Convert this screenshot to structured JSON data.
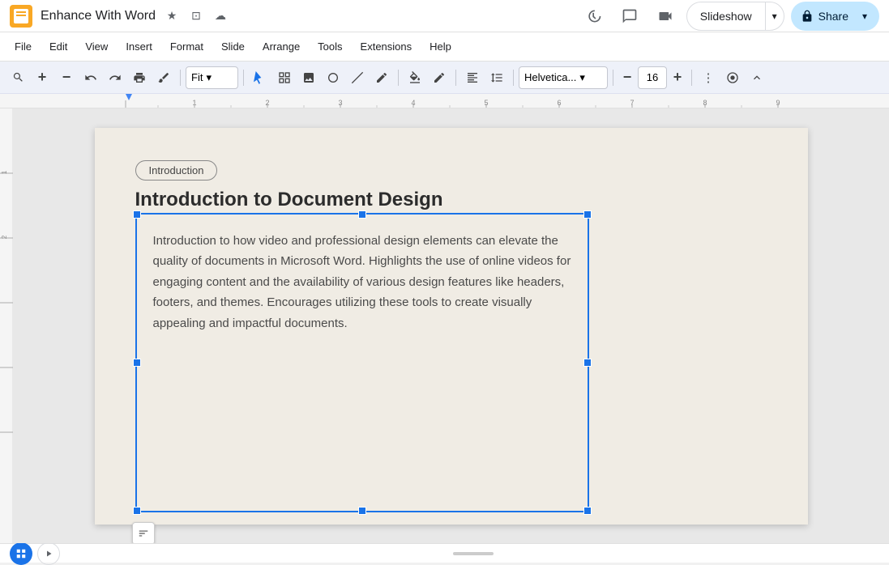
{
  "app": {
    "icon_label": "Google Slides",
    "title": "Enhance With Word",
    "star_icon": "★",
    "drive_icon": "⊡",
    "cloud_icon": "☁"
  },
  "title_bar": {
    "history_icon": "🕐",
    "comment_icon": "💬",
    "camera_icon": "📷"
  },
  "slideshow": {
    "label": "Slideshow",
    "arrow": "▾"
  },
  "share": {
    "label": "Share",
    "arrow": "▾",
    "lock_icon": "🔒"
  },
  "menu": {
    "items": [
      "File",
      "Edit",
      "View",
      "Insert",
      "Format",
      "Slide",
      "Arrange",
      "Tools",
      "Extensions",
      "Help"
    ]
  },
  "toolbar": {
    "search_icon": "🔍",
    "zoom_in": "+",
    "zoom_out": "−",
    "undo": "↩",
    "redo": "↪",
    "print": "🖨",
    "paint": "🎨",
    "zoom_label": "Fit",
    "cursor_icon": "↖",
    "frame_icon": "⊞",
    "image_icon": "🖼",
    "shape_icon": "⬠",
    "line_icon": "╱",
    "pen_icon": "✏",
    "align_icon": "≡",
    "spacing_icon": "↕",
    "font_name": "Helvetica...",
    "font_arrow": "▾",
    "font_size": "16",
    "more_icon": "⋮",
    "circle_icon": "●",
    "expand_icon": "⌃"
  },
  "slide": {
    "tag_label": "Introduction",
    "title": "Introduction to Document Design",
    "body_text": "Introduction to how video and professional design elements can elevate the quality of documents in Microsoft Word. Highlights the use of online videos for engaging content and the availability of various design features like headers, footers, and themes. Encourages utilizing these tools to create visually appealing and impactful documents."
  },
  "bottom": {
    "grid_icon": "⊞",
    "nav_arrow": "›"
  }
}
